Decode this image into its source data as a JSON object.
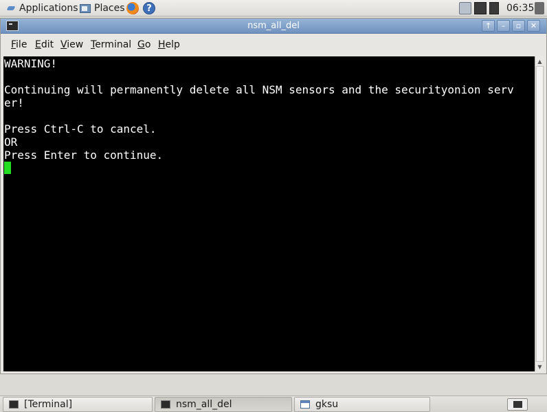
{
  "top_panel": {
    "applications_label": "Applications",
    "places_label": "Places",
    "clock": "06:35"
  },
  "window": {
    "title": "nsm_all_del",
    "controls": {
      "up": "↑",
      "minimize": "–",
      "maximize": "▫",
      "close": "✕"
    },
    "menu": [
      "File",
      "Edit",
      "View",
      "Terminal",
      "Go",
      "Help"
    ],
    "menu_mnemonics": [
      "F",
      "E",
      "V",
      "T",
      "G",
      "H"
    ]
  },
  "terminal": {
    "lines": [
      "WARNING!",
      "",
      "Continuing will permanently delete all NSM sensors and the securityonion serv",
      "er!",
      "",
      "Press Ctrl-C to cancel.",
      "OR",
      "Press Enter to continue."
    ],
    "cursor_color": "#22dd22"
  },
  "taskbar": {
    "tasks": [
      {
        "label": "[Terminal]",
        "icon": "terminal-icon"
      },
      {
        "label": "nsm_all_del",
        "icon": "terminal-icon"
      },
      {
        "label": "gksu",
        "icon": "window-icon"
      }
    ]
  }
}
